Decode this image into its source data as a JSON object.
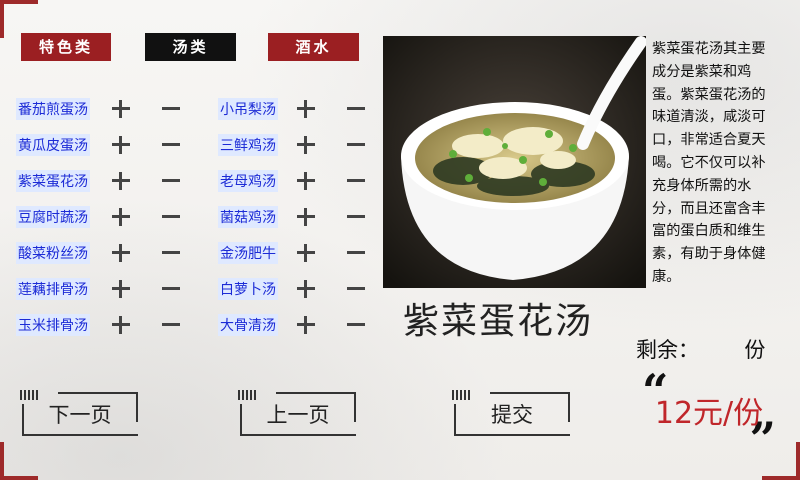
{
  "tabs": {
    "specialty": "特色类",
    "soup": "汤类",
    "drinks": "酒水"
  },
  "left_items": [
    "番茄煎蛋汤",
    "黄瓜皮蛋汤",
    "紫菜蛋花汤",
    "豆腐时蔬汤",
    "酸菜粉丝汤",
    "莲藕排骨汤",
    "玉米排骨汤"
  ],
  "right_items": [
    "小吊梨汤",
    "三鲜鸡汤",
    "老母鸡汤",
    "菌菇鸡汤",
    "金汤肥牛",
    "白萝卜汤",
    "大骨清汤"
  ],
  "dish": {
    "name": "紫菜蛋花汤",
    "description": "紫菜蛋花汤其主要成分是紫菜和鸡蛋。紫菜蛋花汤的味道清淡，咸淡可口，非常适合夏天喝。它不仅可以补充身体所需的水分，而且还富含丰富的蛋白质和维生素，有助于身体健康。",
    "remaining_label": "剩余：",
    "remaining_unit": "份",
    "price": "12元/份"
  },
  "buttons": {
    "next": "下一页",
    "prev": "上一页",
    "submit": "提交"
  },
  "colors": {
    "accent_red": "#9b1f22",
    "item_blue": "#1c2bd6",
    "price_red": "#c0262a"
  }
}
